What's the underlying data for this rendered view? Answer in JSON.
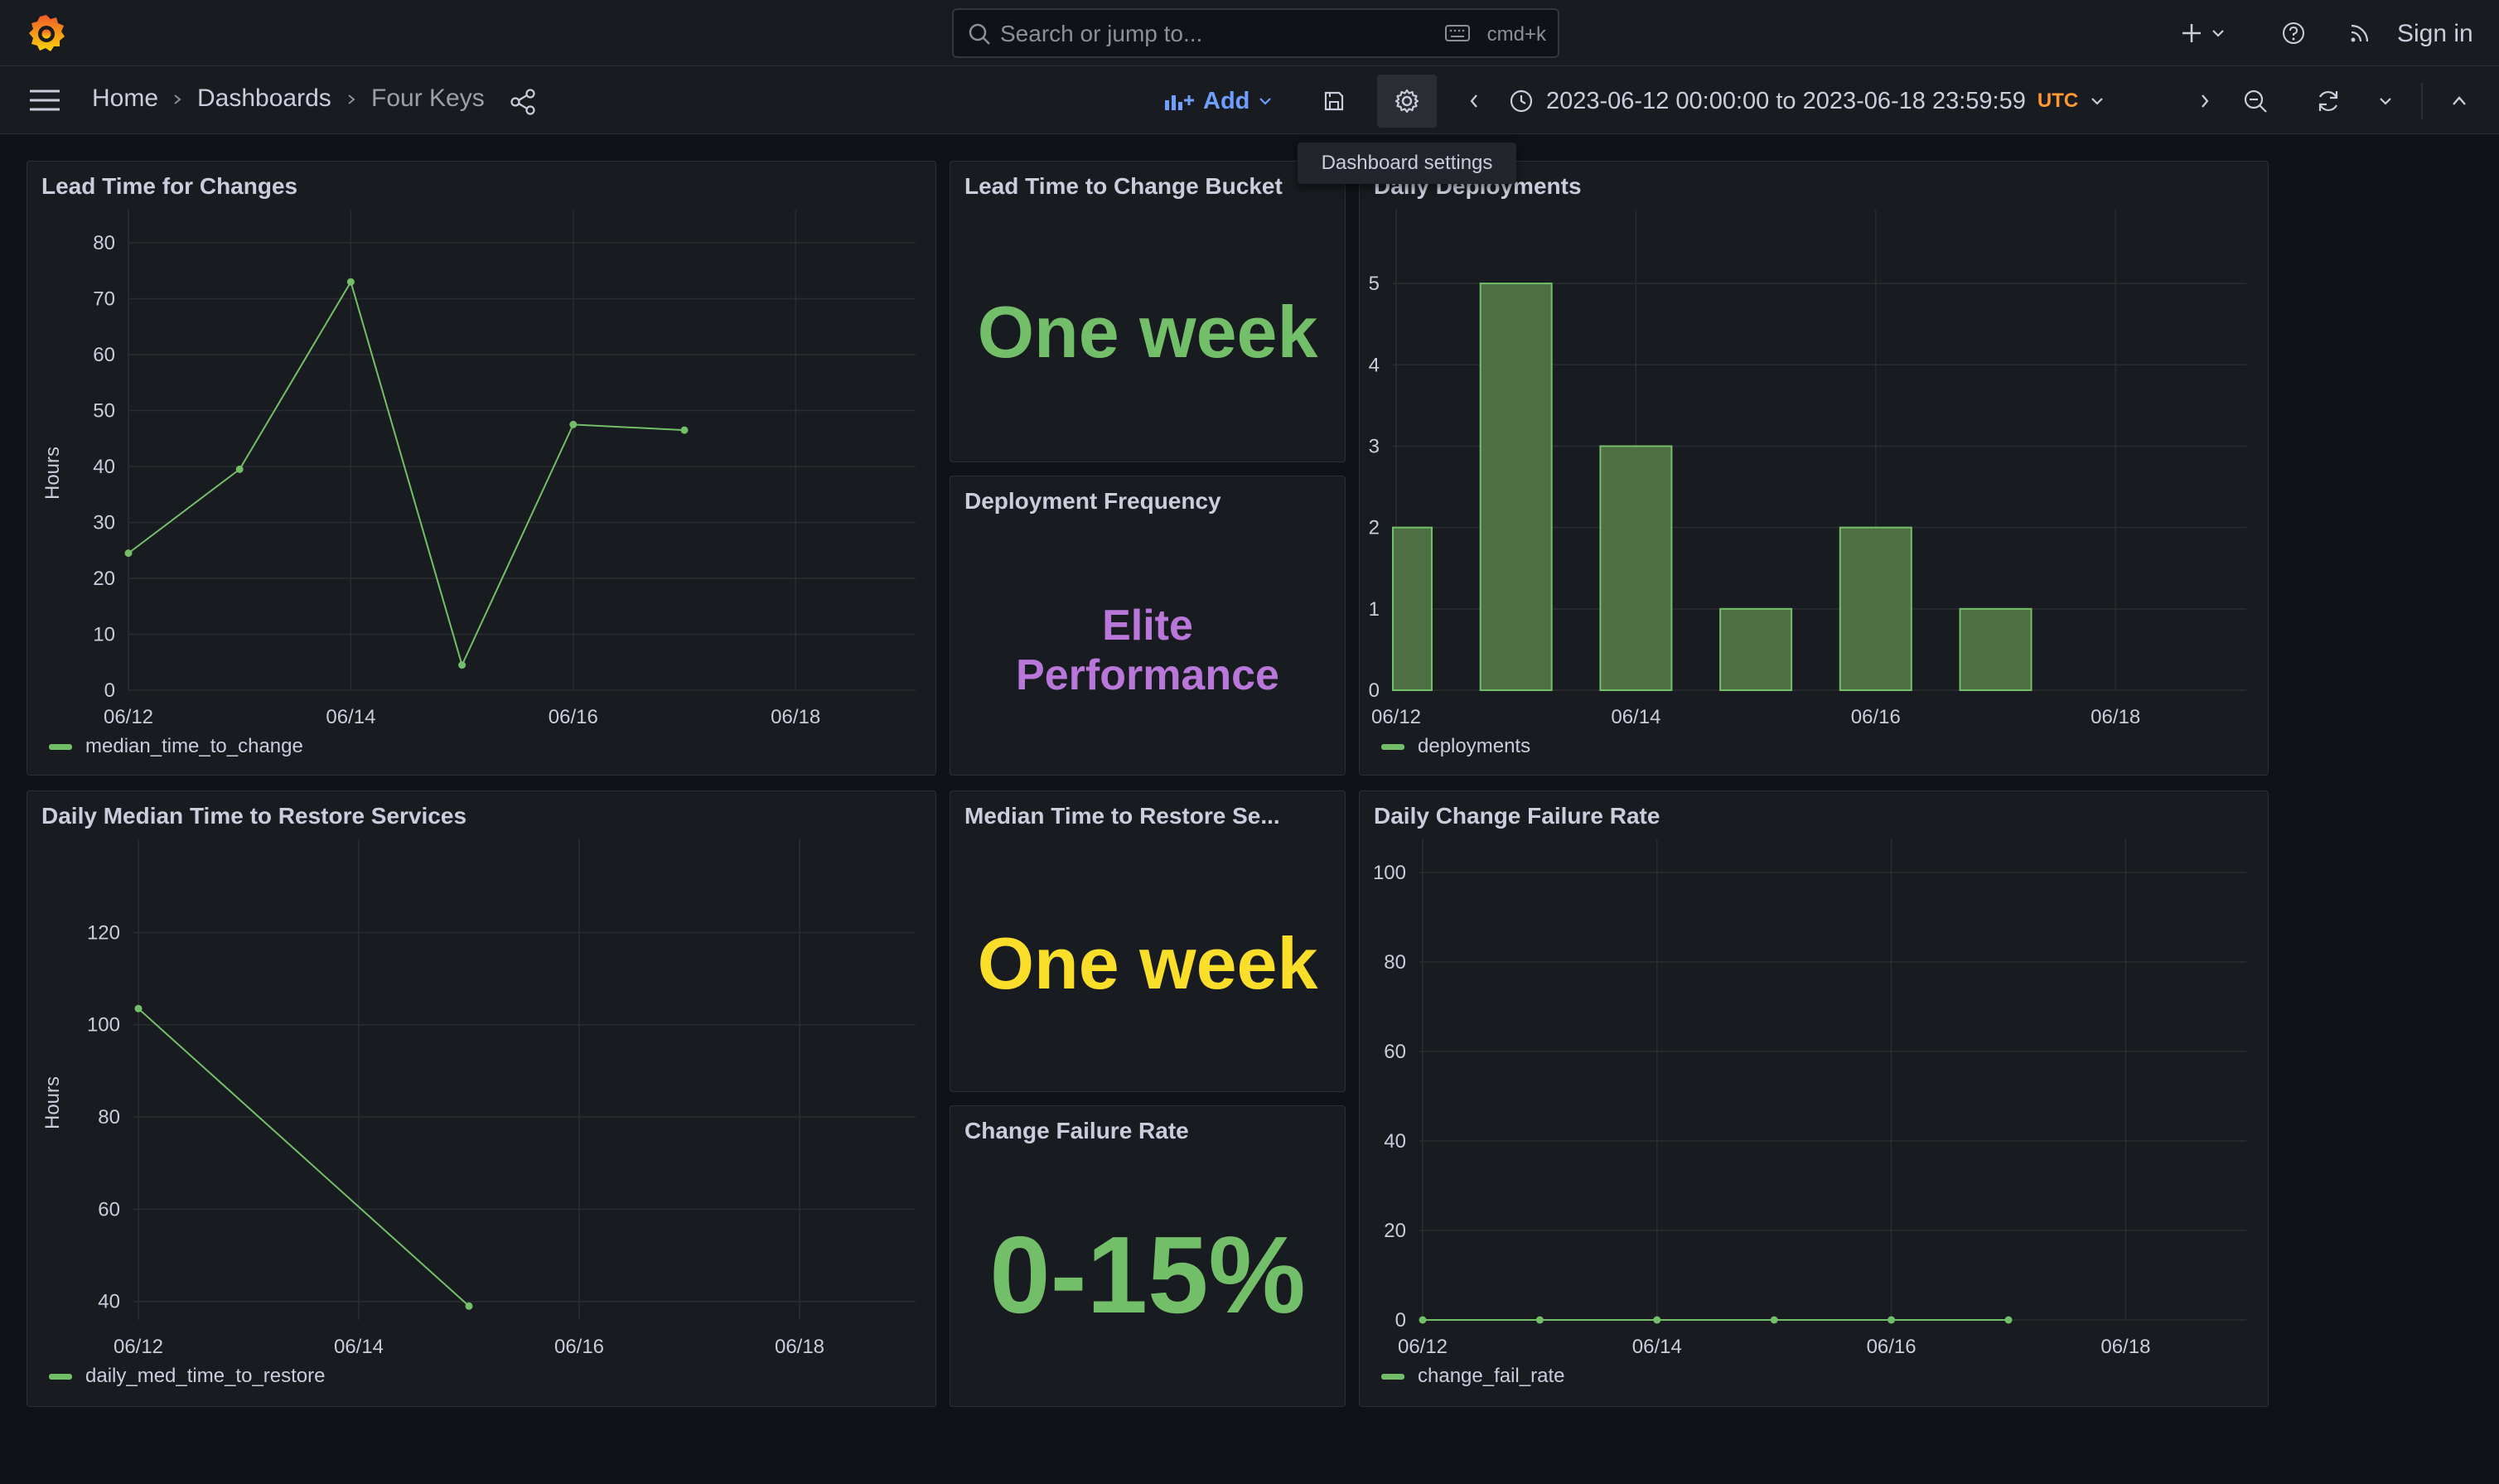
{
  "topbar": {
    "search_placeholder": "Search or jump to...",
    "search_shortcut": "cmd+k",
    "sign_in": "Sign in"
  },
  "navbar": {
    "breadcrumbs": [
      "Home",
      "Dashboards",
      "Four Keys"
    ],
    "add_label": "Add",
    "time_range": "2023-06-12 00:00:00 to 2023-06-18 23:59:59",
    "timezone": "UTC",
    "tooltip": "Dashboard settings"
  },
  "panels": {
    "lead_time": {
      "title": "Lead Time for Changes",
      "legend": "median_time_to_change"
    },
    "lead_bucket": {
      "title": "Lead Time to Change Bucket",
      "value": "One week"
    },
    "daily_deployments": {
      "title": "Daily Deployments",
      "legend": "deployments"
    },
    "deploy_freq": {
      "title": "Deployment Frequency",
      "value_line1": "Elite",
      "value_line2": "Performance"
    },
    "restore_daily": {
      "title": "Daily Median Time to Restore Services",
      "legend": "daily_med_time_to_restore"
    },
    "restore_stat": {
      "title": "Median Time to Restore Se...",
      "value": "One week"
    },
    "cfr_stat": {
      "title": "Change Failure Rate",
      "value": "0-15%"
    },
    "cfr_daily": {
      "title": "Daily Change Failure Rate",
      "legend": "change_fail_rate"
    }
  },
  "colors": {
    "green": "#73bf69",
    "yellow": "#fade2a",
    "purple": "#b877d9",
    "accent_blue": "#6e9fff",
    "orange": "#ff9830",
    "bar_fill": "#4e6e44"
  },
  "chart_data": [
    {
      "id": "lead_time",
      "type": "line",
      "title": "Lead Time for Changes",
      "ylabel": "Hours",
      "x_ticks": [
        "06/12",
        "06/14",
        "06/16",
        "06/18"
      ],
      "y_ticks": [
        0,
        10,
        20,
        30,
        40,
        50,
        60,
        70,
        80
      ],
      "ylim": [
        0,
        80
      ],
      "xlim": [
        "2023-06-12",
        "2023-06-18"
      ],
      "series": [
        {
          "name": "median_time_to_change",
          "x": [
            "2023-06-12",
            "2023-06-13",
            "2023-06-14",
            "2023-06-15",
            "2023-06-16",
            "2023-06-17"
          ],
          "values": [
            24.5,
            39.5,
            73,
            4.5,
            47.5,
            46.5
          ]
        }
      ]
    },
    {
      "id": "daily_deployments",
      "type": "bar",
      "title": "Daily Deployments",
      "x_ticks": [
        "06/12",
        "06/14",
        "06/16",
        "06/18"
      ],
      "y_ticks": [
        0,
        1,
        2,
        3,
        4,
        5
      ],
      "ylim": [
        0,
        5.5
      ],
      "xlim": [
        "2023-06-12",
        "2023-06-18"
      ],
      "series": [
        {
          "name": "deployments",
          "x": [
            "2023-06-12",
            "2023-06-13",
            "2023-06-14",
            "2023-06-15",
            "2023-06-16",
            "2023-06-17"
          ],
          "values": [
            2,
            5,
            3,
            1,
            2,
            1
          ]
        }
      ]
    },
    {
      "id": "restore_daily",
      "type": "line",
      "title": "Daily Median Time to Restore Services",
      "ylabel": "Hours",
      "x_ticks": [
        "06/12",
        "06/14",
        "06/16",
        "06/18"
      ],
      "y_ticks": [
        40,
        60,
        80,
        100,
        120
      ],
      "ylim": [
        36,
        133
      ],
      "xlim": [
        "2023-06-12",
        "2023-06-18"
      ],
      "series": [
        {
          "name": "daily_med_time_to_restore",
          "x": [
            "2023-06-12",
            "2023-06-15"
          ],
          "values": [
            103.5,
            39
          ]
        }
      ]
    },
    {
      "id": "cfr_daily",
      "type": "line",
      "title": "Daily Change Failure Rate",
      "x_ticks": [
        "06/12",
        "06/14",
        "06/16",
        "06/18"
      ],
      "y_ticks": [
        0,
        20,
        40,
        60,
        80,
        100
      ],
      "ylim": [
        0,
        100
      ],
      "xlim": [
        "2023-06-12",
        "2023-06-18"
      ],
      "series": [
        {
          "name": "change_fail_rate",
          "x": [
            "2023-06-12",
            "2023-06-13",
            "2023-06-14",
            "2023-06-15",
            "2023-06-16",
            "2023-06-17"
          ],
          "values": [
            0,
            0,
            0,
            0,
            0,
            0
          ]
        }
      ]
    }
  ]
}
